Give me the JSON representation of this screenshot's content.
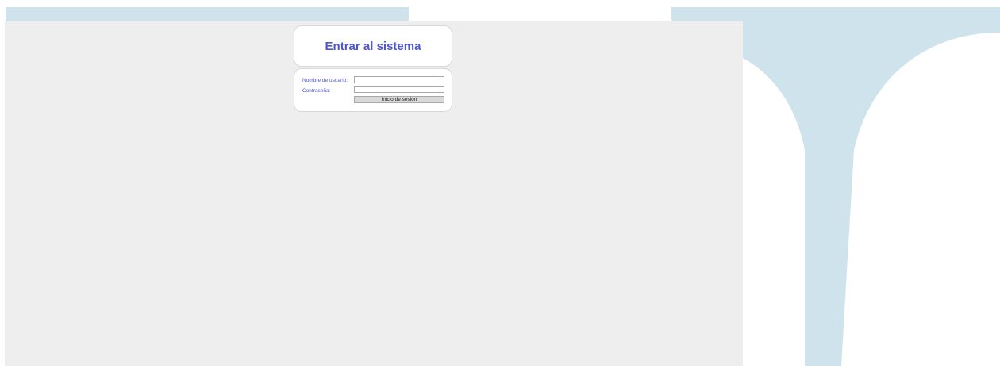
{
  "login": {
    "title": "Entrar al sistema",
    "username_label": "Nombre de usuario:",
    "username_value": "",
    "password_label": "Contraseña:",
    "password_value": "",
    "submit_label": "Inicio de sesión"
  },
  "colors": {
    "title_text": "#4f56d6",
    "label_text": "#4f56d6",
    "panel_background": "#eeeeee",
    "decoration_blue": "#cfe3ec",
    "button_background": "#d9d9d9"
  }
}
